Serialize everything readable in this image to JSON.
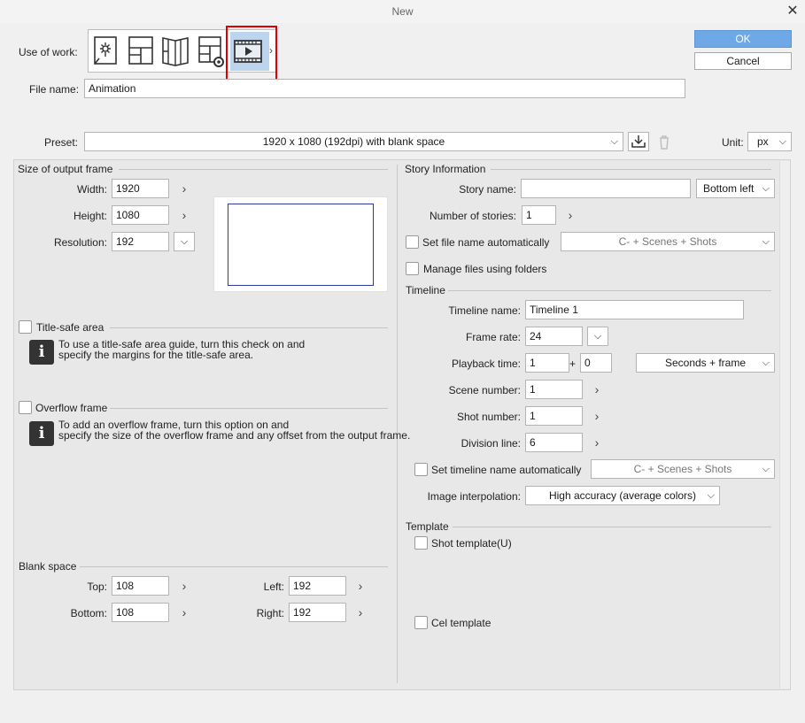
{
  "window": {
    "title": "New",
    "close_glyph": "✕"
  },
  "use_of_work": {
    "label": "Use of work:",
    "options": [
      {
        "icon": "illustration-icon"
      },
      {
        "icon": "comic-icon"
      },
      {
        "icon": "comic-book-icon"
      },
      {
        "icon": "comic-settings-icon"
      },
      {
        "icon": "animation-icon",
        "selected": true
      }
    ],
    "more_glyph": "›"
  },
  "buttons": {
    "ok": "OK",
    "cancel": "Cancel"
  },
  "file_name": {
    "label": "File name:",
    "value": "Animation"
  },
  "preset": {
    "label": "Preset:",
    "value": "1920 x 1080 (192dpi) with blank space"
  },
  "unit": {
    "label": "Unit:",
    "value": "px"
  },
  "output_frame": {
    "section": "Size of output frame",
    "width": {
      "label": "Width:",
      "value": "1920"
    },
    "height": {
      "label": "Height:",
      "value": "1080"
    },
    "resolution": {
      "label": "Resolution:",
      "value": "192"
    }
  },
  "title_safe": {
    "label": "Title-safe area",
    "info_line1": "To use a title-safe area guide, turn this check on and",
    "info_line2": "specify the margins for the title-safe area."
  },
  "overflow": {
    "label": "Overflow frame",
    "info_line1": "To add an overflow frame, turn this option on and",
    "info_line2": "specify the size of the overflow frame and any offset from the output frame."
  },
  "blank_space": {
    "section": "Blank space",
    "top": {
      "label": "Top:",
      "value": "108"
    },
    "bottom": {
      "label": "Bottom:",
      "value": "108"
    },
    "left": {
      "label": "Left:",
      "value": "192"
    },
    "right": {
      "label": "Right:",
      "value": "192"
    }
  },
  "story": {
    "section": "Story Information",
    "story_name": {
      "label": "Story name:",
      "value": "",
      "position": "Bottom left"
    },
    "stories": {
      "label": "Number of stories:",
      "value": "1"
    },
    "auto_file_name": {
      "label": "Set file name automatically",
      "pattern": "C- + Scenes + Shots"
    },
    "folders": {
      "label": "Manage files using folders"
    }
  },
  "timeline": {
    "section": "Timeline",
    "name": {
      "label": "Timeline name:",
      "value": "Timeline 1"
    },
    "frame_rate": {
      "label": "Frame rate:",
      "value": "24"
    },
    "playback": {
      "label": "Playback time:",
      "value1": "1",
      "plus": "+",
      "value2": "0",
      "mode": "Seconds + frame"
    },
    "scene": {
      "label": "Scene number:",
      "value": "1"
    },
    "shot": {
      "label": "Shot number:",
      "value": "1"
    },
    "division": {
      "label": "Division line:",
      "value": "6"
    },
    "auto_name": {
      "label": "Set timeline name automatically",
      "pattern": "C- + Scenes + Shots"
    },
    "interp": {
      "label": "Image interpolation:",
      "value": "High accuracy (average colors)"
    }
  },
  "template": {
    "section": "Template",
    "shot": "Shot template(U)",
    "cel": "Cel template"
  },
  "glyphs": {
    "chev_right": "›",
    "chev_down": "⌵"
  },
  "colors": {
    "ok_button": "#6fa8e6",
    "highlight": "#e00000",
    "frame_border": "#2a3c9e"
  }
}
